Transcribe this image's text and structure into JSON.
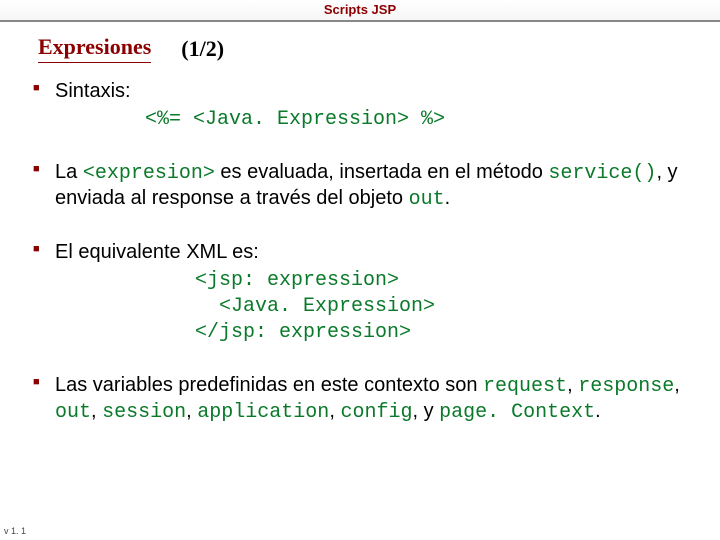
{
  "header": {
    "bar_title": "Scripts JSP"
  },
  "title": {
    "main": "Expresiones",
    "page": "(1/2)"
  },
  "bullets": {
    "b1": {
      "label": "Sintaxis:",
      "code": "<%= <Java. Expression> %>"
    },
    "b2": {
      "pre": "La ",
      "code1": "<expresion>",
      "mid1": " es evaluada, insertada en el método ",
      "code2": "service()",
      "mid2": ", y enviada al response a través del objeto ",
      "code3": "out",
      "tail": "."
    },
    "b3": {
      "label": "El equivalente XML es:",
      "code": "<jsp: expression>\n  <Java. Expression>\n</jsp: expression>"
    },
    "b4": {
      "pre": "Las variables predefinidas en este contexto son ",
      "code1": "request",
      "s1": ", ",
      "code2": "response",
      "s2": ", ",
      "code3": "out",
      "s3": ", ",
      "code4": "session",
      "s4": ", ",
      "code5": "application",
      "s5": ", ",
      "code6": "config",
      "s6": ", y ",
      "code7": "page. Context",
      "tail": "."
    }
  },
  "footer": {
    "version": "v 1. 1"
  }
}
